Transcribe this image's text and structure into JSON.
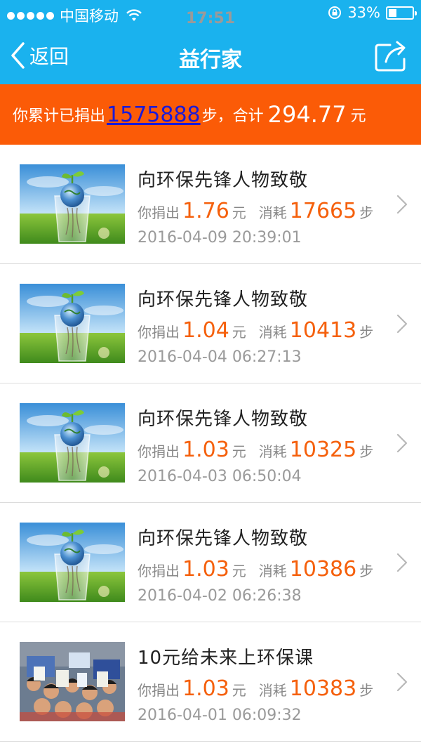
{
  "status": {
    "carrier": "中国移动",
    "time": "17:51",
    "battery": "33%",
    "battery_level": 0.33
  },
  "nav": {
    "back_label": "返回",
    "title": "益行家",
    "share_icon": "share-icon"
  },
  "summary": {
    "prefix": "你累计已捐出",
    "steps": "1575888",
    "mid": "步，合计",
    "amount": "294.77",
    "suffix": "元"
  },
  "items": [
    {
      "title": "向环保先锋人物致敬",
      "donated_label": "你捐出",
      "amount": "1.76",
      "yuan": "元",
      "consumed_label": "消耗",
      "steps": "17665",
      "steps_unit": "步",
      "datetime": "2016-04-09 20:39:01",
      "thumb": "plant-glass-image"
    },
    {
      "title": "向环保先锋人物致敬",
      "donated_label": "你捐出",
      "amount": "1.04",
      "yuan": "元",
      "consumed_label": "消耗",
      "steps": "10413",
      "steps_unit": "步",
      "datetime": "2016-04-04 06:27:13",
      "thumb": "plant-glass-image"
    },
    {
      "title": "向环保先锋人物致敬",
      "donated_label": "你捐出",
      "amount": "1.03",
      "yuan": "元",
      "consumed_label": "消耗",
      "steps": "10325",
      "steps_unit": "步",
      "datetime": "2016-04-03 06:50:04",
      "thumb": "plant-glass-image"
    },
    {
      "title": "向环保先锋人物致敬",
      "donated_label": "你捐出",
      "amount": "1.03",
      "yuan": "元",
      "consumed_label": "消耗",
      "steps": "10386",
      "steps_unit": "步",
      "datetime": "2016-04-02 06:26:38",
      "thumb": "plant-glass-image"
    },
    {
      "title": "10元给未来上环保课",
      "donated_label": "你捐出",
      "amount": "1.03",
      "yuan": "元",
      "consumed_label": "消耗",
      "steps": "10383",
      "steps_unit": "步",
      "datetime": "2016-04-01 06:09:32",
      "thumb": "children-photo"
    }
  ],
  "colors": {
    "nav_bg": "#1ab2ee",
    "summary_bg": "#fb5b07",
    "accent_number": "#f5600c",
    "link_steps": "#1a1ad8"
  }
}
